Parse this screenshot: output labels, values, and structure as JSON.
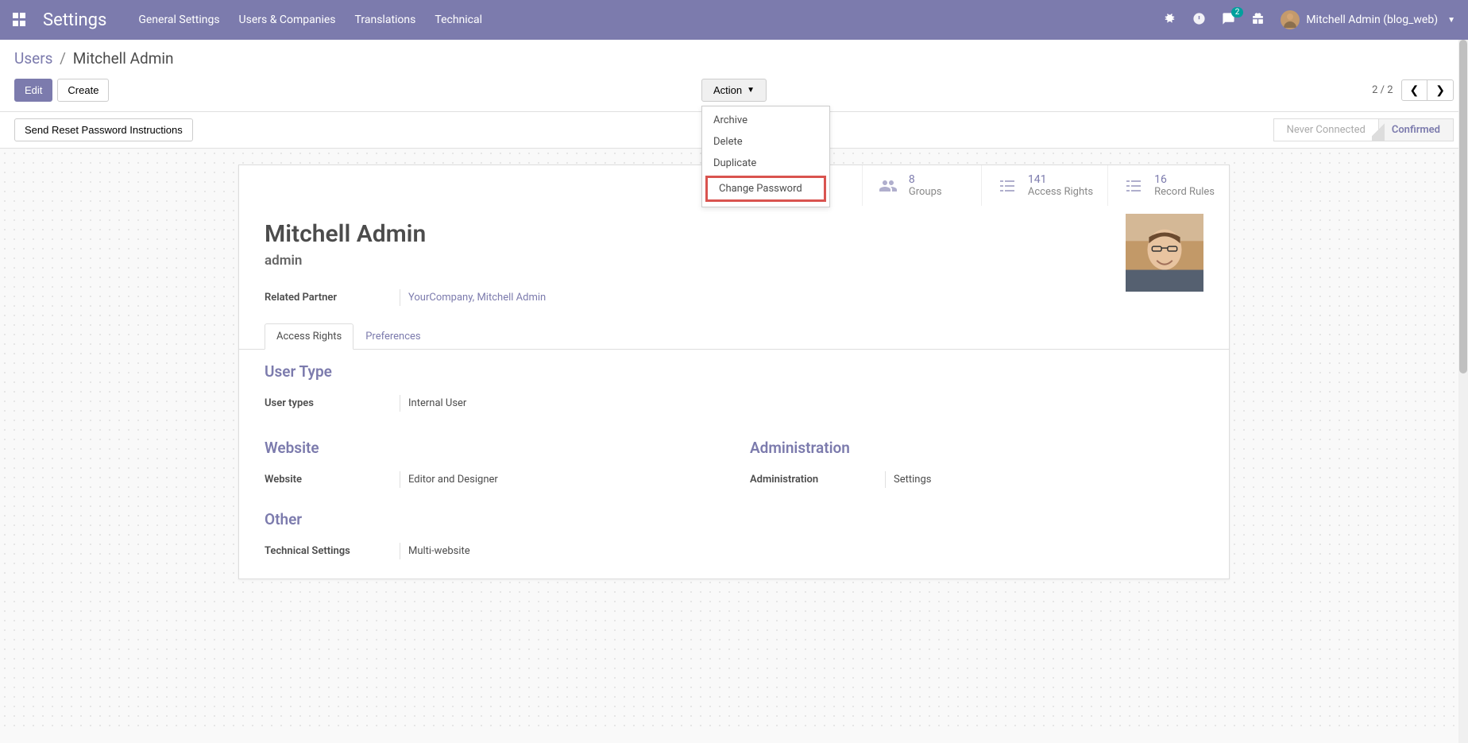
{
  "topnav": {
    "brand": "Settings",
    "menu": [
      "General Settings",
      "Users & Companies",
      "Translations",
      "Technical"
    ],
    "chat_badge": "2",
    "user_name": "Mitchell Admin (blog_web)"
  },
  "breadcrumb": {
    "root": "Users",
    "current": "Mitchell Admin"
  },
  "buttons": {
    "edit": "Edit",
    "create": "Create",
    "action": "Action",
    "send_reset": "Send Reset Password Instructions"
  },
  "action_menu": {
    "archive": "Archive",
    "delete": "Delete",
    "duplicate": "Duplicate",
    "change_password": "Change Password"
  },
  "pager": "2 / 2",
  "status": {
    "never_connected": "Never Connected",
    "confirmed": "Confirmed"
  },
  "stats": {
    "groups": {
      "num": "8",
      "label": "Groups"
    },
    "access": {
      "num": "141",
      "label": "Access Rights"
    },
    "rules": {
      "num": "16",
      "label": "Record Rules"
    }
  },
  "record": {
    "name": "Mitchell Admin",
    "login": "admin",
    "related_partner_label": "Related Partner",
    "related_partner_value": "YourCompany, Mitchell Admin"
  },
  "tabs": {
    "access_rights": "Access Rights",
    "preferences": "Preferences"
  },
  "sections": {
    "user_type": {
      "heading": "User Type",
      "label": "User types",
      "value": "Internal User"
    },
    "website": {
      "heading": "Website",
      "label": "Website",
      "value": "Editor and Designer"
    },
    "administration": {
      "heading": "Administration",
      "label": "Administration",
      "value": "Settings"
    },
    "other": {
      "heading": "Other",
      "label": "Technical Settings",
      "value": "Multi-website"
    }
  }
}
